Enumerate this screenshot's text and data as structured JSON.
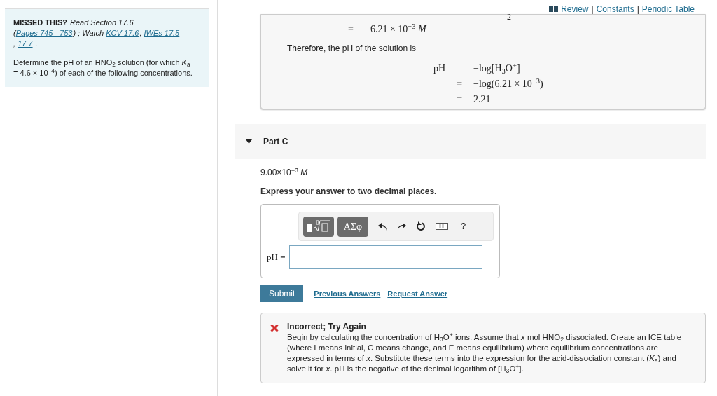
{
  "sidebar": {
    "missed_label": "MISSED THIS?",
    "read_text": "Read Section 17.6",
    "links_line": [
      {
        "kind": "text",
        "text": "("
      },
      {
        "kind": "link",
        "text": "Pages 745 - 753"
      },
      {
        "kind": "text",
        "text": ") ; Watch "
      },
      {
        "kind": "link",
        "text": "KCV 17.6"
      },
      {
        "kind": "text",
        "text": ", "
      },
      {
        "kind": "link",
        "text": "IWEs 17.5"
      },
      {
        "kind": "text",
        "text": ", "
      },
      {
        "kind": "link",
        "text": "17.7"
      },
      {
        "kind": "text",
        "text": " ."
      }
    ],
    "prompt": "Determine the pH of an HNO$_{2}$ solution (for which *K*$_{a}$ = 4.6 × 10$^{−4}$) of each of the following concentrations."
  },
  "top_links": {
    "items": [
      "Review",
      "Constants",
      "Periodic Table"
    ],
    "separator": "|"
  },
  "solution": {
    "cut_off": "2",
    "concentration": {
      "sign": "=",
      "value": "6.21 × 10$^{−3}$ *M*"
    },
    "sentence": "Therefore, the pH of the solution is",
    "steps": [
      {
        "lhs": "pH",
        "sign": "=",
        "rhs": "−log[H$_{3}$O$^{+}$]"
      },
      {
        "sign": "=",
        "rhs": "−log(6.21 × 10$^{−3}$)"
      },
      {
        "sign": "=",
        "rhs": "2.21"
      }
    ]
  },
  "part": {
    "title": "Part C",
    "expanded": true,
    "given": "9.00×10$^{−3}$ *M*",
    "instruction": "Express your answer to two decimal places.",
    "toolbar": {
      "templates": "ΑΣφ",
      "help": "?"
    },
    "field_label": "pH =",
    "buttons": {
      "submit": "Submit",
      "previous": "Previous Answers",
      "request": "Request Answer"
    }
  },
  "feedback": {
    "kind": "incorrect",
    "title": "Incorrect; Try Again",
    "text": "Begin by calculating the concentration of H$_{3}$O$^{+}$ ions. Assume that *x* mol HNO$_{2}$ dissociated. Create an ICE table (where I means initial, C means change, and E means equilibrium) where equilibrium concentrations are expressed in terms of *x*. Substitute these terms into the expression for the acid-dissociation constant (*K*$_{a}$) and solve it for *x*. pH is the negative of the decimal logarithm of [H$_{3}$O$^{+}$]."
  }
}
